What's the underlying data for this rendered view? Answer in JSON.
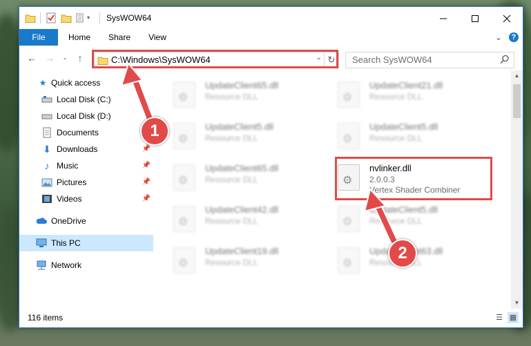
{
  "window": {
    "title": "SysWOW64"
  },
  "ribbon": {
    "tabs": [
      "File",
      "Home",
      "Share",
      "View"
    ]
  },
  "address": {
    "path": "C:\\Windows\\SysWOW64",
    "search_placeholder": "Search SysWOW64"
  },
  "nav": {
    "items": [
      {
        "label": "Quick access",
        "icon": "star-icon",
        "pinned": false
      },
      {
        "label": "Local Disk (C:)",
        "icon": "drive-icon",
        "pinned": false
      },
      {
        "label": "Local Disk (D:)",
        "icon": "drive-icon",
        "pinned": false
      },
      {
        "label": "Documents",
        "icon": "documents-icon",
        "pinned": true
      },
      {
        "label": "Downloads",
        "icon": "download-icon",
        "pinned": true
      },
      {
        "label": "Music",
        "icon": "music-icon",
        "pinned": true
      },
      {
        "label": "Pictures",
        "icon": "pictures-icon",
        "pinned": true
      },
      {
        "label": "Videos",
        "icon": "videos-icon",
        "pinned": true
      },
      {
        "label": "OneDrive",
        "icon": "cloud-icon",
        "pinned": false
      },
      {
        "label": "This PC",
        "icon": "pc-icon",
        "pinned": false,
        "selected": true
      },
      {
        "label": "Network",
        "icon": "network-icon",
        "pinned": false
      }
    ]
  },
  "files": [
    {
      "name": "UpdateClient65.dll",
      "type": "Resource DLL"
    },
    {
      "name": "UpdateClient21.dll",
      "type": "Resource DLL"
    },
    {
      "name": "UpdateClient5.dll",
      "type": "Resource DLL"
    },
    {
      "name": "UpdateClient5.dll",
      "type": "Resource DLL"
    },
    {
      "name": "UpdateClient65.dll",
      "type": "Resource DLL"
    },
    {
      "name": "nvlinker.dll",
      "version": "2.0.0.3",
      "type": "Vertex Shader Combiner",
      "highlighted": true
    },
    {
      "name": "UpdateClient42.dll",
      "type": "Resource DLL"
    },
    {
      "name": "UpdateClient5.dll",
      "type": "Resource DLL"
    },
    {
      "name": "UpdateClient19.dll",
      "type": "Resource DLL"
    },
    {
      "name": "UpdateClient63.dll",
      "type": "Resource DLL"
    }
  ],
  "status": {
    "item_count": "116 items"
  },
  "annotations": {
    "step1": "1",
    "step2": "2"
  },
  "colors": {
    "accent": "#1979ca",
    "highlight": "#e24a4a",
    "selection": "#cce8ff"
  }
}
